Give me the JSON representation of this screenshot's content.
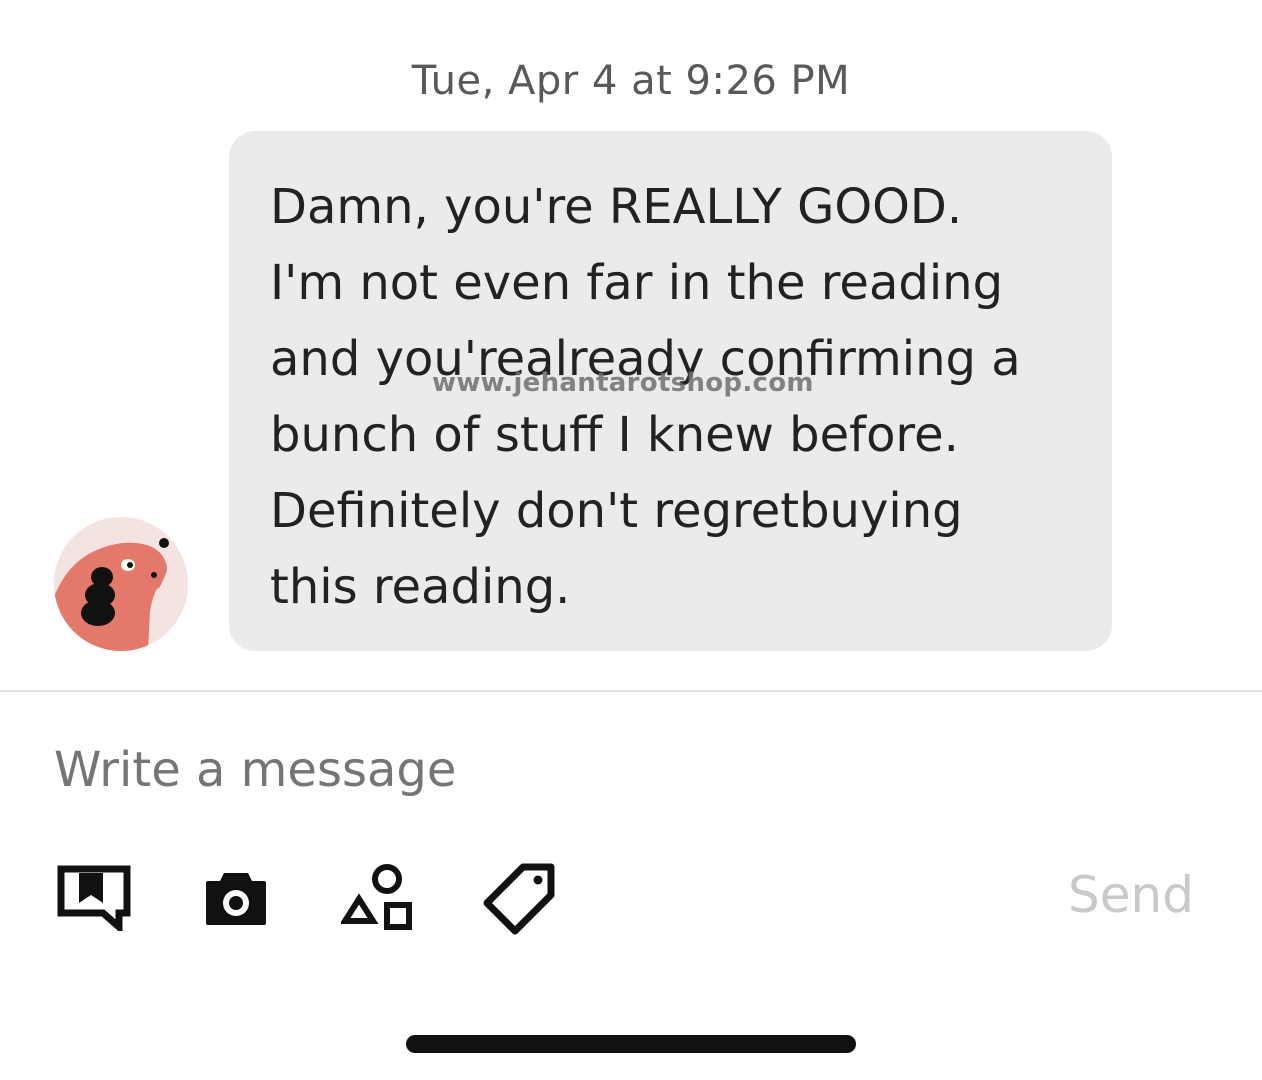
{
  "conversation": {
    "timestamp": "Tue, Apr 4 at 9:26 PM",
    "message": {
      "text": "Damn, you're REALLY GOOD.\nI'm not even far in the reading\nand you'realready confirming a\nbunch of stuff I knew before.\nDefinitely don't regretbuying\nthis reading.",
      "watermark": "www.jehantarotshop.com"
    },
    "avatar_icon": "dog-avatar-icon"
  },
  "composer": {
    "placeholder": "Write a message",
    "value": "",
    "send_label": "Send",
    "tools": [
      {
        "name": "order-receipt-icon"
      },
      {
        "name": "camera-icon"
      },
      {
        "name": "shapes-icon"
      },
      {
        "name": "tag-icon"
      }
    ]
  },
  "colors": {
    "bubble": "#ebebeb",
    "avatar_accent": "#e4786a",
    "send_disabled": "#c9c9c9"
  }
}
